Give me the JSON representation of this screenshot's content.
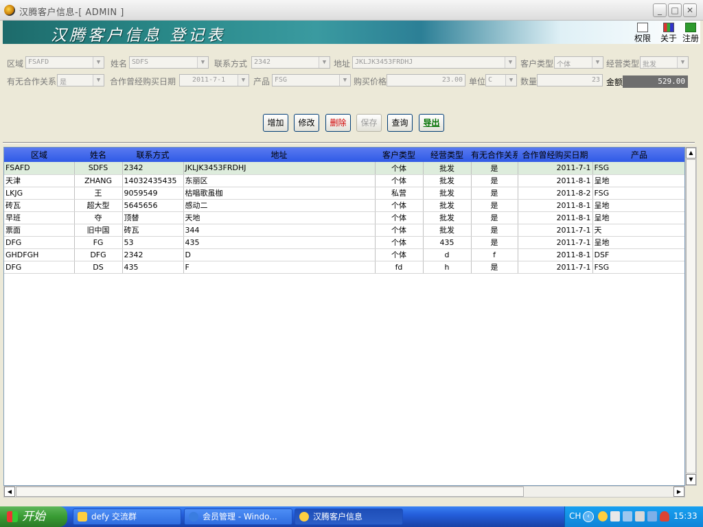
{
  "window": {
    "title": "汉腾客户信息-[ ADMIN ]",
    "min": "_",
    "max": "□",
    "close": "✕"
  },
  "banner": {
    "heading": "汉腾客户信息 登记表",
    "buttons": {
      "perm": "权限",
      "about": "关于",
      "logout": "注册"
    }
  },
  "form": {
    "region_label": "区域",
    "region_value": "FSAFD",
    "name_label": "姓名",
    "name_value": "SDFS",
    "contact_label": "联系方式",
    "contact_value": "2342",
    "address_label": "地址",
    "address_value": "JKLJK3453FRDHJ",
    "customer_type_label": "客户类型",
    "customer_type_value": "个体",
    "business_type_label": "经营类型",
    "business_type_value": "批发",
    "partner_label": "有无合作关系",
    "partner_value": "是",
    "purchase_date_label": "合作曾经购买日期",
    "purchase_date_value": "2011-7-1",
    "product_label": "产品",
    "product_value": "FSG",
    "price_label": "购买价格",
    "price_value": "23.00",
    "unit_label": "单位",
    "unit_value": "C",
    "quantity_label": "数量",
    "quantity_value": "23",
    "amount_label": "金额",
    "amount_value": "529.00"
  },
  "actions": {
    "add": "增加",
    "edit": "修改",
    "delete": "删除",
    "save": "保存",
    "query": "查询",
    "export": "导出"
  },
  "table": {
    "headers": [
      "区域",
      "姓名",
      "联系方式",
      "地址",
      "客户类型",
      "经营类型",
      "有无合作关系",
      "合作曾经购买日期",
      "产品"
    ],
    "rows": [
      [
        "FSAFD",
        "SDFS",
        "2342",
        "JKLJK3453FRDHJ",
        "个体",
        "批发",
        "是",
        "2011-7-1",
        "FSG"
      ],
      [
        "天津",
        "ZHANG",
        "14032435435",
        "东丽区",
        "个体",
        "批发",
        "是",
        "2011-8-1",
        "呈地"
      ],
      [
        "LKJG",
        "王",
        "9059549",
        "枯唱歌虽枷",
        "私营",
        "批发",
        "是",
        "2011-8-2",
        "FSG"
      ],
      [
        "砖瓦",
        "超大型",
        "5645656",
        "感动二",
        "个体",
        "批发",
        "是",
        "2011-8-1",
        "呈地"
      ],
      [
        "早班",
        "夺",
        "顶替",
        "天地",
        "个体",
        "批发",
        "是",
        "2011-8-1",
        "呈地"
      ],
      [
        "票面",
        "旧中国",
        "砖瓦",
        "344",
        "个体",
        "批发",
        "是",
        "2011-7-1",
        "天"
      ],
      [
        "DFG",
        "FG",
        "53",
        "435",
        "个体",
        "435",
        "是",
        "2011-7-1",
        "呈地"
      ],
      [
        "GHDFGH",
        "DFG",
        "2342",
        "D",
        "个体",
        "d",
        "f",
        "2011-8-1",
        "DSF"
      ],
      [
        "DFG",
        "DS",
        "435",
        "F",
        "fd",
        "h",
        "是",
        "2011-7-1",
        "FSG"
      ]
    ]
  },
  "scroll": {
    "up": "▲",
    "down": "▼",
    "left": "◀",
    "right": "▶"
  },
  "taskbar": {
    "start": "开始",
    "tasks": [
      "defy 交流群",
      "会员管理 - Windo...",
      "汉腾客户信息"
    ],
    "lang": "CH",
    "expand": "‹",
    "clock": "15:33"
  }
}
